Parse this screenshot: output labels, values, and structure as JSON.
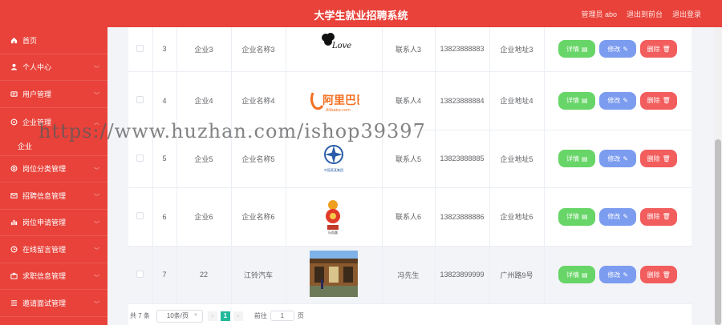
{
  "header": {
    "title": "大学生就业招聘系统",
    "admin": "管理员 abo",
    "back_frontend": "退出到前台",
    "logout": "退出登录"
  },
  "sidebar": {
    "items": [
      {
        "label": "首页",
        "icon": "home-icon"
      },
      {
        "label": "个人中心",
        "icon": "user-icon"
      },
      {
        "label": "用户管理",
        "icon": "users-icon"
      },
      {
        "label": "企业管理",
        "icon": "company-icon",
        "sub": [
          "企业"
        ]
      },
      {
        "label": "岗位分类管理",
        "icon": "category-icon"
      },
      {
        "label": "招聘信息管理",
        "icon": "message-icon"
      },
      {
        "label": "岗位申请管理",
        "icon": "apply-icon"
      },
      {
        "label": "在线留言管理",
        "icon": "comment-icon"
      },
      {
        "label": "求职信息管理",
        "icon": "resume-icon"
      },
      {
        "label": "邀请面试管理",
        "icon": "interview-icon"
      }
    ]
  },
  "table": {
    "rows": [
      {
        "index": "3",
        "account": "企业3",
        "name": "企业名称3",
        "logo": "love-logo",
        "contact": "联系人3",
        "phone": "13823888883",
        "address": "企业地址3"
      },
      {
        "index": "4",
        "account": "企业4",
        "name": "企业名称4",
        "logo": "alibaba-logo",
        "logo_text": "阿里巴巴",
        "logo_sub": "Alibaba.com",
        "contact": "联系人4",
        "phone": "13823888884",
        "address": "企业地址4"
      },
      {
        "index": "5",
        "account": "企业5",
        "name": "企业名称5",
        "logo": "cross-logo",
        "logo_text": "中国某某集团",
        "contact": "联系人5",
        "phone": "13823888885",
        "address": "企业地址5"
      },
      {
        "index": "6",
        "account": "企业6",
        "name": "企业名称6",
        "logo": "mascot-logo",
        "logo_text": "乐而惠",
        "contact": "联系人6",
        "phone": "13823888886",
        "address": "企业地址6"
      },
      {
        "index": "7",
        "account": "22",
        "name": "江铃汽车",
        "logo": "shopfront-photo",
        "contact": "冯先生",
        "phone": "13823899999",
        "address": "广州路9号"
      }
    ],
    "actions": {
      "detail": "详情",
      "edit": "修改",
      "delete": "删除"
    }
  },
  "pagination": {
    "total": "共 7 条",
    "page_size": "10条/页",
    "current_page": "1",
    "goto_label": "前往",
    "goto_value": "1",
    "goto_unit": "页"
  },
  "watermark": "https://www.huzhan.com/ishop39397",
  "colors": {
    "primary": "#e8423a",
    "detail": "#67d567",
    "edit": "#7c9cf0",
    "delete": "#f25d5d",
    "page_active": "#23b99a"
  }
}
